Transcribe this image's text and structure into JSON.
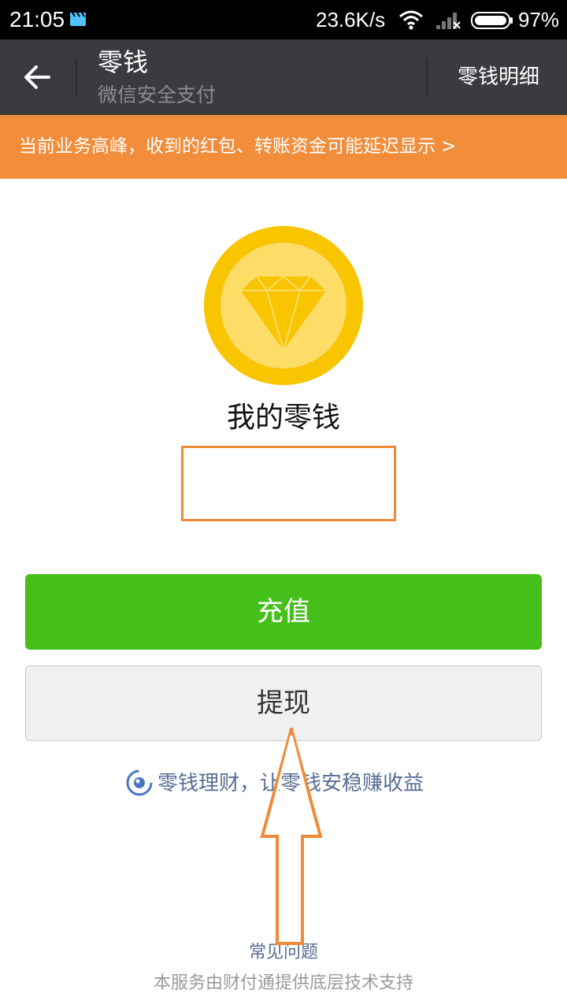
{
  "status_bar": {
    "time": "21:05",
    "app_icon": "clapper-icon",
    "network_speed": "23.6K/s",
    "wifi_icon": "wifi-icon",
    "signal_icon": "signal-icon",
    "battery_icon": "battery-icon",
    "battery_percent": "97%"
  },
  "header": {
    "back_icon": "back-arrow-icon",
    "title": "零钱",
    "subtitle": "微信安全支付",
    "detail_link": "零钱明细",
    "background": "#3a3b3f"
  },
  "notice": {
    "text": "当前业务高峰，收到的红包、转账资金可能延迟显示 >",
    "background": "#f18d3b"
  },
  "balance": {
    "icon": "diamond-coin-icon",
    "label": "我的零钱",
    "amount": ""
  },
  "buttons": {
    "recharge": "充值",
    "withdraw": "提现",
    "recharge_color": "#45c01a"
  },
  "licai": {
    "icon": "licaitong-icon",
    "text": "零钱理财，让零钱安稳赚收益"
  },
  "footer": {
    "faq": "常见问题",
    "support": "本服务由财付通提供底层技术支持"
  },
  "annotation": {
    "color": "#f08a36",
    "icon": "up-arrow-annotation-icon"
  }
}
